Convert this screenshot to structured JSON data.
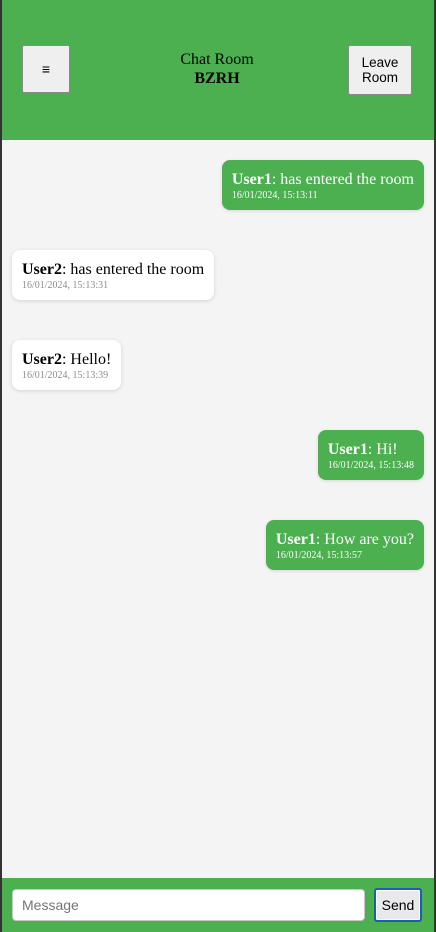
{
  "header": {
    "menu_icon": "≡",
    "title": "Chat Room",
    "room_code": "BZRH",
    "leave_label": "Leave Room"
  },
  "messages": [
    {
      "user": "User1",
      "text": ": has entered the room",
      "time": "16/01/2024, 15:13:11",
      "own": true
    },
    {
      "user": "User2",
      "text": ": has entered the room",
      "time": "16/01/2024, 15:13:31",
      "own": false
    },
    {
      "user": "User2",
      "text": ": Hello!",
      "time": "16/01/2024, 15:13:39",
      "own": false
    },
    {
      "user": "User1",
      "text": ": Hi!",
      "time": "16/01/2024, 15:13:48",
      "own": true
    },
    {
      "user": "User1",
      "text": ": How are you?",
      "time": "16/01/2024, 15:13:57",
      "own": true
    }
  ],
  "composer": {
    "placeholder": "Message",
    "value": "",
    "send_label": "Send"
  },
  "colors": {
    "accent": "#4caf50",
    "background": "#f4f4f4",
    "incoming_bubble": "#ffffff"
  }
}
